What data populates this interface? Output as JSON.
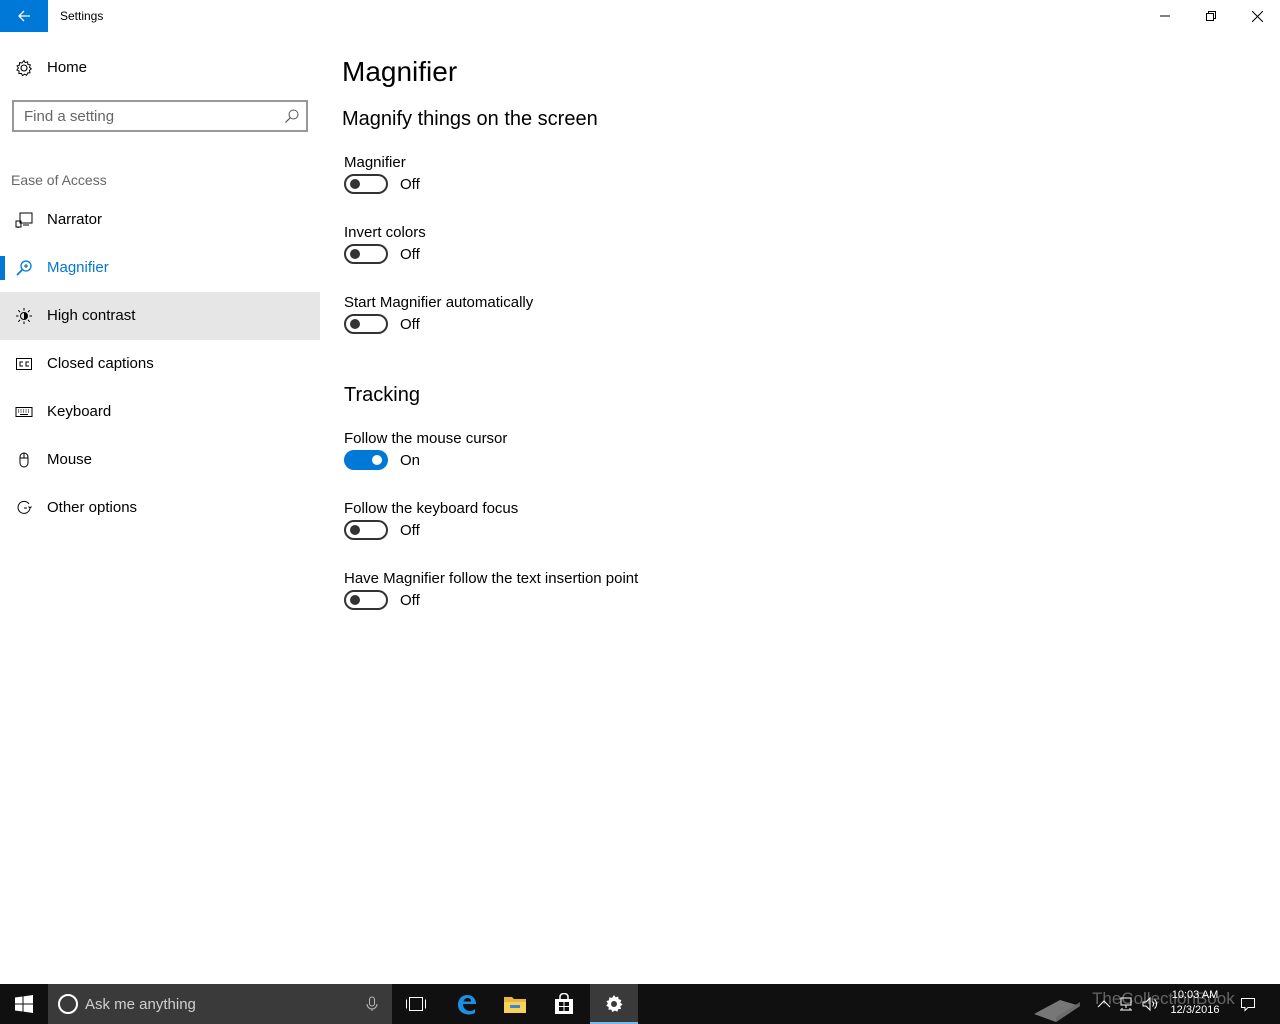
{
  "window": {
    "title": "Settings"
  },
  "sidebar": {
    "home_label": "Home",
    "search_placeholder": "Find a setting",
    "section_header": "Ease of Access",
    "items": [
      {
        "label": "Narrator",
        "icon": "narrator-icon",
        "selected": false
      },
      {
        "label": "Magnifier",
        "icon": "magnifier-icon",
        "selected": true
      },
      {
        "label": "High contrast",
        "icon": "high-contrast-icon",
        "selected": false,
        "hover": true
      },
      {
        "label": "Closed captions",
        "icon": "closed-captions-icon",
        "selected": false
      },
      {
        "label": "Keyboard",
        "icon": "keyboard-icon",
        "selected": false
      },
      {
        "label": "Mouse",
        "icon": "mouse-icon",
        "selected": false
      },
      {
        "label": "Other options",
        "icon": "other-options-icon",
        "selected": false
      }
    ]
  },
  "main": {
    "page_title": "Magnifier",
    "groups": [
      {
        "title": "Magnify things on the screen",
        "settings": [
          {
            "label": "Magnifier",
            "state": "Off",
            "on": false
          },
          {
            "label": "Invert colors",
            "state": "Off",
            "on": false
          },
          {
            "label": "Start Magnifier automatically",
            "state": "Off",
            "on": false
          }
        ]
      },
      {
        "title": "Tracking",
        "settings": [
          {
            "label": "Follow the mouse cursor",
            "state": "On",
            "on": true
          },
          {
            "label": "Follow the keyboard focus",
            "state": "Off",
            "on": false
          },
          {
            "label": "Have Magnifier follow the text insertion point",
            "state": "Off",
            "on": false
          }
        ]
      }
    ]
  },
  "taskbar": {
    "search_placeholder": "Ask me anything",
    "time": "10:03 AM",
    "date": "12/3/2016",
    "watermark": "TheCollectionBook"
  },
  "colors": {
    "accent": "#0078d7",
    "hover": "#e6e6e6",
    "taskbar": "#101010"
  }
}
